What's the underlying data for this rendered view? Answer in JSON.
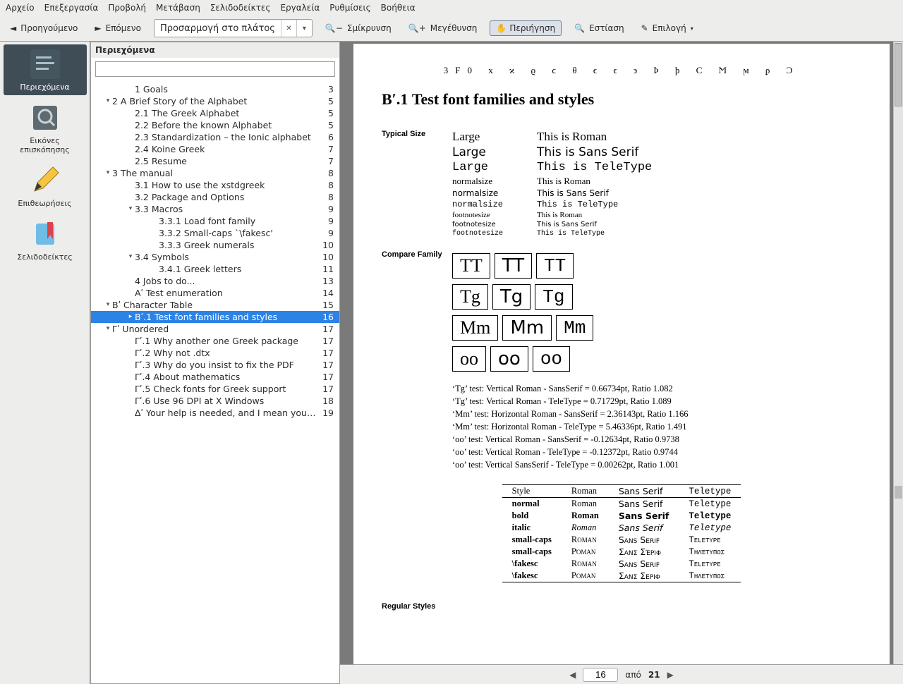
{
  "menu": {
    "items": [
      "Αρχείο",
      "Επεξεργασία",
      "Προβολή",
      "Μετάβαση",
      "Σελιδοδείκτες",
      "Εργαλεία",
      "Ρυθμίσεις",
      "Βοήθεια"
    ]
  },
  "toolbar": {
    "prev": "Προηγούμενο",
    "next": "Επόμενο",
    "zoom_mode": "Προσαρμογή στο πλάτος",
    "zoom_out": "Σμίκρυνση",
    "zoom_in": "Μεγέθυνση",
    "browse": "Περιήγηση",
    "focus": "Εστίαση",
    "select": "Επιλογή"
  },
  "sidebar": {
    "tabs": [
      {
        "label": "Περιεχόμενα",
        "icon": "contents"
      },
      {
        "label": "Εικόνες επισκόπησης",
        "icon": "thumbnails"
      },
      {
        "label": "Επιθεωρήσεις",
        "icon": "reviews"
      },
      {
        "label": "Σελιδοδείκτες",
        "icon": "bookmarks"
      }
    ],
    "selected": 0
  },
  "contents": {
    "title": "Περιεχόμενα",
    "search_placeholder": "",
    "nodes": [
      {
        "ind": 2,
        "tog": "",
        "t": "1 Goals",
        "p": "3"
      },
      {
        "ind": 1,
        "tog": "▾",
        "t": "2 A Brief Story of the Alphabet",
        "p": "5"
      },
      {
        "ind": 2,
        "tog": "",
        "t": "2.1 The Greek Alphabet",
        "p": "5"
      },
      {
        "ind": 2,
        "tog": "",
        "t": "2.2 Before the known Alphabet",
        "p": "5"
      },
      {
        "ind": 2,
        "tog": "",
        "t": "2.3 Standardization – the Ionic alphabet",
        "p": "6"
      },
      {
        "ind": 2,
        "tog": "",
        "t": "2.4 Koine Greek",
        "p": "7"
      },
      {
        "ind": 2,
        "tog": "",
        "t": "2.5 Resume",
        "p": "7"
      },
      {
        "ind": 1,
        "tog": "▾",
        "t": "3 The manual",
        "p": "8"
      },
      {
        "ind": 2,
        "tog": "",
        "t": "3.1 How to use the xstdgreek",
        "p": "8"
      },
      {
        "ind": 2,
        "tog": "",
        "t": "3.2 Package and Options",
        "p": "8"
      },
      {
        "ind": 2,
        "tog": "▾",
        "t": "3.3 Macros",
        "p": "9"
      },
      {
        "ind": 3,
        "tog": "",
        "t": "3.3.1 Load font family",
        "p": "9"
      },
      {
        "ind": 3,
        "tog": "",
        "t": "3.3.2 Small-caps `\\fakesc'",
        "p": "9"
      },
      {
        "ind": 3,
        "tog": "",
        "t": "3.3.3 Greek numerals",
        "p": "10"
      },
      {
        "ind": 2,
        "tog": "▾",
        "t": "3.4 Symbols",
        "p": "10"
      },
      {
        "ind": 3,
        "tog": "",
        "t": "3.4.1 Greek letters",
        "p": "11"
      },
      {
        "ind": 2,
        "tog": "",
        "t": "4 Jobs to do...",
        "p": "13"
      },
      {
        "ind": 2,
        "tog": "",
        "t": "Αʹ Test enumeration",
        "p": "14"
      },
      {
        "ind": 1,
        "tog": "▾",
        "t": "Βʹ Character Table",
        "p": "15"
      },
      {
        "ind": 2,
        "tog": "▸",
        "t": "Βʹ.1 Test font families and styles",
        "p": "16",
        "sel": true
      },
      {
        "ind": 1,
        "tog": "▾",
        "t": "Γʹ Unordered",
        "p": "17"
      },
      {
        "ind": 2,
        "tog": "",
        "t": "Γʹ.1 Why another one Greek package",
        "p": "17"
      },
      {
        "ind": 2,
        "tog": "",
        "t": "Γʹ.2 Why not .dtx",
        "p": "17"
      },
      {
        "ind": 2,
        "tog": "",
        "t": "Γʹ.3 Why do you insist to fix the PDF",
        "p": "17"
      },
      {
        "ind": 2,
        "tog": "",
        "t": "Γʹ.4 About mathematics",
        "p": "17"
      },
      {
        "ind": 2,
        "tog": "",
        "t": "Γʹ.5 Check fonts for Greek support",
        "p": "17"
      },
      {
        "ind": 2,
        "tog": "",
        "t": "Γʹ.6 Use 96 DPI at X Windows",
        "p": "18"
      },
      {
        "ind": 2,
        "tog": "",
        "t": "Δʹ Your help is needed, and I mean your feedback",
        "p": "19"
      }
    ]
  },
  "doc": {
    "char_row": "3F0  x  ϰ  ϱ  ϲ  θ  ϵ  ϵ  ϶  Ϸ  ϸ  Ϲ  Ϻ  ϻ  ϼ  Ͻ",
    "heading": "Βʹ.1   Test font families and styles",
    "typical": "Typical Size",
    "sizes": [
      {
        "s": "Large",
        "cls": "",
        "v": "This is Roman",
        "fz": "17px"
      },
      {
        "s": "Large",
        "cls": "sans",
        "v": "This is Sans Serif",
        "fz": "17px"
      },
      {
        "s": "Large",
        "cls": "mono",
        "v": "This is TeleType",
        "fz": "17px"
      },
      {
        "s": "normalsize",
        "cls": "",
        "v": "This is Roman",
        "fz": "13px"
      },
      {
        "s": "normalsize",
        "cls": "sans",
        "v": "This is Sans Serif",
        "fz": "12px"
      },
      {
        "s": "normalsize",
        "cls": "mono",
        "v": "This is TeleType",
        "fz": "12px"
      },
      {
        "s": "footnotesize",
        "cls": "",
        "v": "This is Roman",
        "fz": "11px"
      },
      {
        "s": "footnotesize",
        "cls": "sans",
        "v": "This is Sans Serif",
        "fz": "10px"
      },
      {
        "s": "footnotesize",
        "cls": "mono",
        "v": "This is TeleType",
        "fz": "10px"
      }
    ],
    "compare": "Compare Family",
    "boxes": [
      [
        "TT",
        "TT",
        "TT"
      ],
      [
        "Tg",
        "Tg",
        "Tg"
      ],
      [
        "Mm",
        "Mm",
        "Mm"
      ],
      [
        "oo",
        "oo",
        "oo"
      ]
    ],
    "tests": [
      "‘Tg’ test: Vertical Roman - SansSerif = 0.66734pt, Ratio 1.082",
      "‘Tg’ test: Vertical Roman - TeleType = 0.71729pt, Ratio 1.089",
      "‘Mm’ test: Horizontal Roman - SansSerif = 2.36143pt, Ratio 1.166",
      "‘Mm’ test: Horizontal Roman - TeleType = 5.46336pt, Ratio 1.491",
      "‘oo’ test: Vertical Roman - SansSerif = -0.12634pt, Ratio 0.9738",
      "‘oo’ test: Vertical Roman - TeleType = -0.12372pt, Ratio 0.9744",
      "‘oo’ test: Vertical SansSerif - TeleType = 0.00262pt, Ratio 1.001"
    ],
    "stable": {
      "head": [
        "Style",
        "Roman",
        "Sans Serif",
        "Teletype"
      ],
      "rows": [
        [
          "normal",
          "Roman",
          "Sans Serif",
          "Teletype"
        ],
        [
          "bold",
          "Roman",
          "Sans Serif",
          "Teletype"
        ],
        [
          "italic",
          "Roman",
          "Sans Serif",
          "Teletype"
        ],
        [
          "small-caps",
          "Roman",
          "Sans Serif",
          "Teletype"
        ],
        [
          "small-caps",
          "Ρόμαν",
          "Σανς Σέριφ",
          "Τηλέτυπος"
        ],
        [
          "\\fakesc",
          "Roman",
          "Sans Serif",
          "Teletype"
        ],
        [
          "\\fakesc",
          "Ρομαν",
          "Σανς Σεριφ",
          "Τηλετυποσ"
        ]
      ]
    },
    "regular": "Regular Styles"
  },
  "pagenav": {
    "current": "16",
    "of_label": "από",
    "total": "21"
  }
}
